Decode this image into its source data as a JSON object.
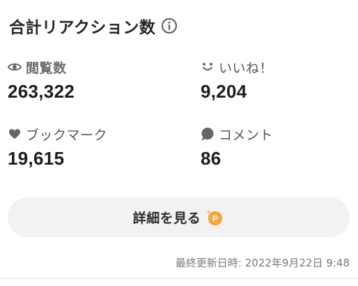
{
  "header": {
    "title": "合計リアクション数",
    "info_icon": "info-circle-icon"
  },
  "stats": {
    "views": {
      "label": "閲覧数",
      "value": "263,322",
      "icon": "eye-icon"
    },
    "likes": {
      "label": "いいね！",
      "value": "9,204",
      "icon": "smile-face-icon"
    },
    "bookmarks": {
      "label": "ブックマーク",
      "value": "19,615",
      "icon": "heart-icon"
    },
    "comments": {
      "label": "コメント",
      "value": "86",
      "icon": "speech-bubble-icon"
    }
  },
  "details_button": {
    "label": "詳細を見る",
    "icon": "point-coin-icon",
    "icon_letter": "P"
  },
  "footer": {
    "last_updated": "最終更新日時: 2022年9月22日 9:48"
  },
  "colors": {
    "icon_gray": "#666666",
    "button_bg": "#f2f2f2",
    "point_orange": "#f29a2e"
  }
}
